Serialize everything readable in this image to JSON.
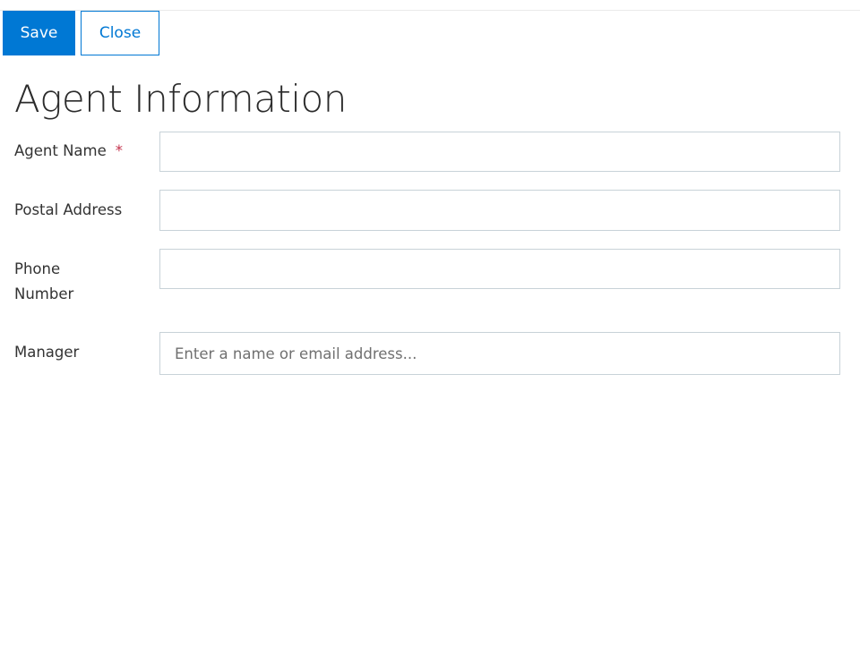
{
  "toolbar": {
    "save_label": "Save",
    "close_label": "Close"
  },
  "page": {
    "title": "Agent Information"
  },
  "form": {
    "agent_name": {
      "label": "Agent Name",
      "required_marker": "*",
      "value": ""
    },
    "postal_address": {
      "label": "Postal Address",
      "value": ""
    },
    "phone_number": {
      "label_line1": "Phone",
      "label_line2": "Number",
      "value": ""
    },
    "manager": {
      "label": "Manager",
      "value": "",
      "placeholder": "Enter a name or email address..."
    }
  },
  "colors": {
    "accent": "#0078d4",
    "required": "#c4314b",
    "input_border": "#c8d2d8"
  }
}
